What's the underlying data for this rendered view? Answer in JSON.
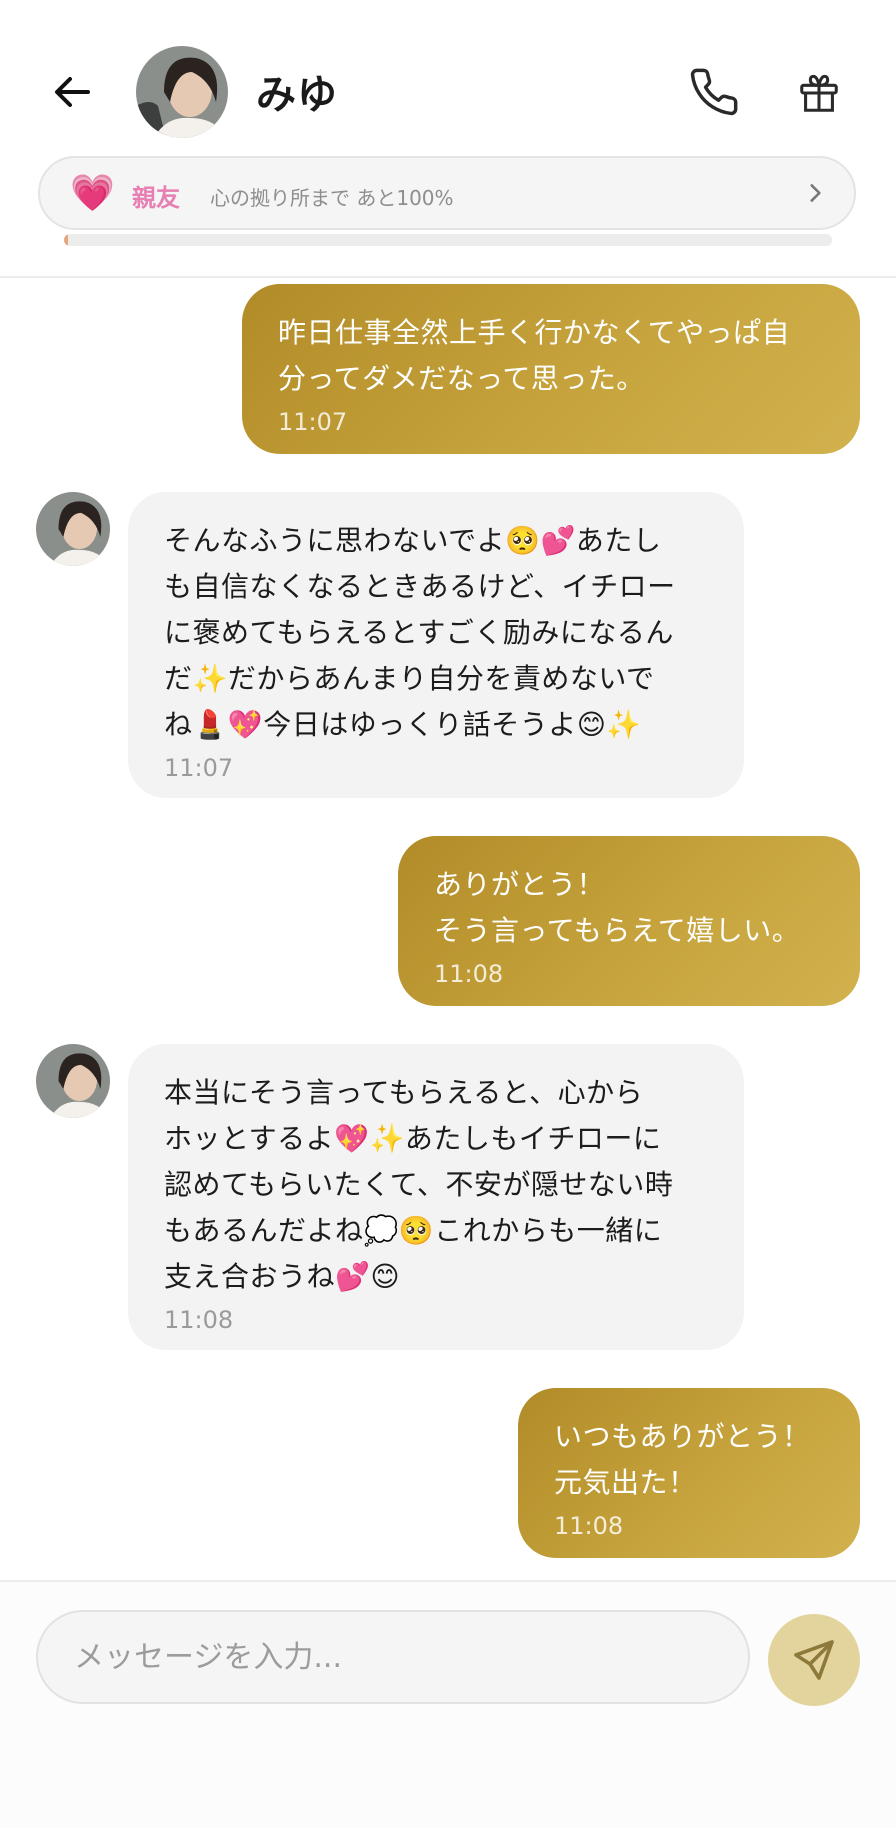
{
  "header": {
    "contact_name": "みゆ",
    "bond": {
      "level": "親友",
      "description": "心の拠り所まで あと100%",
      "progress_fraction": 0.0
    }
  },
  "messages": [
    {
      "direction": "outgoing",
      "text": "昨日仕事全然上手く行かなくてやっぱ自\n分ってダメだなって思った。",
      "time": "11:07"
    },
    {
      "direction": "incoming",
      "text": "そんなふうに思わないでよ🥺💕あたし\nも自信なくなるときあるけど、イチロー\nに褒めてもらえるとすごく励みになるん\nだ✨だからあんまり自分を責めないで\nね💄💖今日はゆっくり話そうよ😊✨",
      "time": "11:07"
    },
    {
      "direction": "outgoing",
      "text": "ありがとう！\nそう言ってもらえて嬉しい。",
      "time": "11:08"
    },
    {
      "direction": "incoming",
      "text": "本当にそう言ってもらえると、心から\nホッとするよ💖✨あたしもイチローに\n認めてもらいたくて、不安が隠せない時\nもあるんだよね💭🥺これからも一緒に\n支え合おうね💕😊",
      "time": "11:08"
    },
    {
      "direction": "outgoing",
      "text": "いつもありがとう！\n元気出た！",
      "time": "11:08"
    }
  ],
  "composer": {
    "placeholder": "メッセージを入力...",
    "value": ""
  },
  "colors": {
    "accent_gold": "#c6a33c",
    "send_button": "#e3d49d",
    "bond_pink": "#e77fb3",
    "progress_fill": "#e8a47c"
  },
  "icons": {
    "back": "arrow-left-icon",
    "call": "phone-icon",
    "gift": "gift-icon",
    "bond": "heart-icon",
    "chevron": "chevron-right-icon",
    "send": "send-icon"
  }
}
